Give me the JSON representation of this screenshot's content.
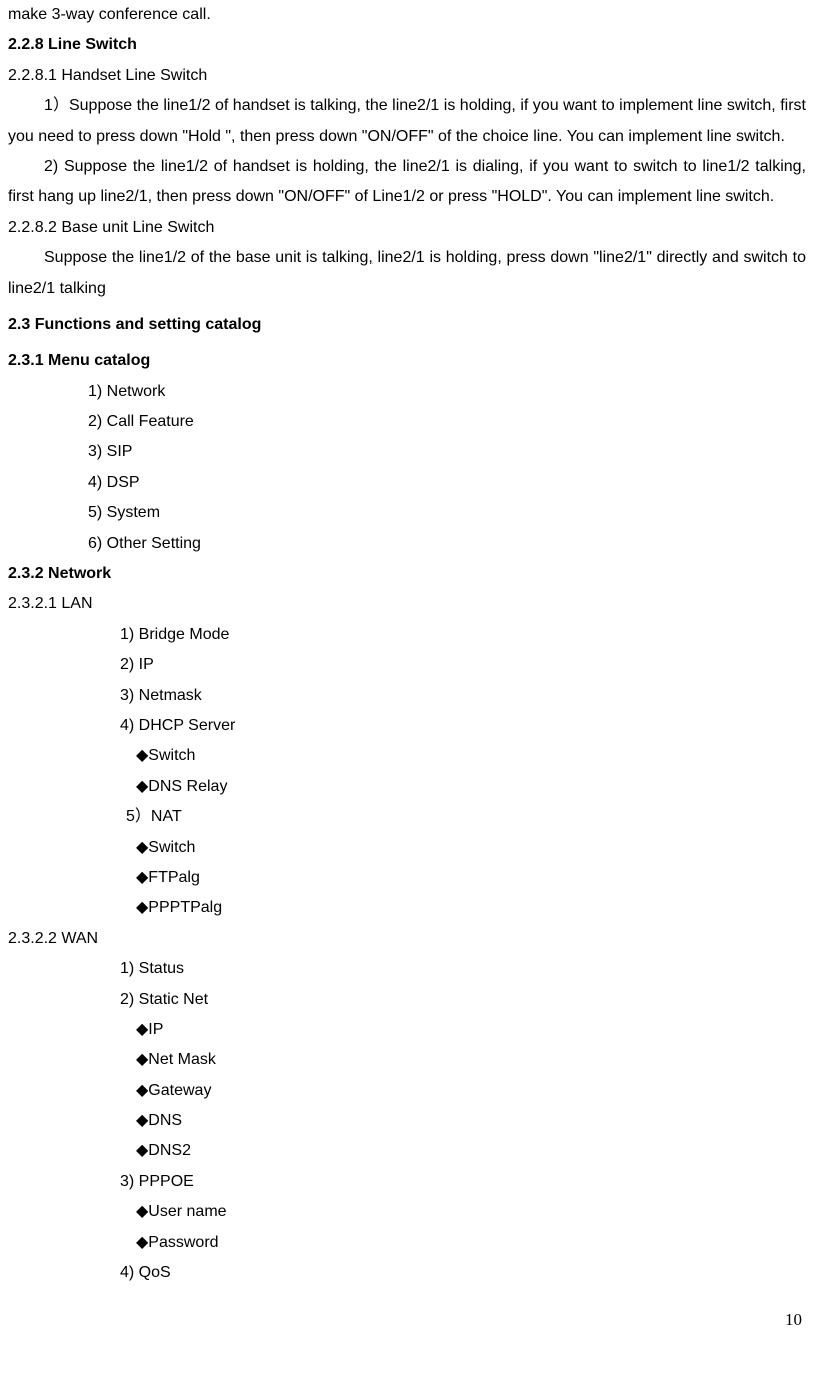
{
  "intro_line": "make 3-way conference call.",
  "s228_title": "2.2.8 Line Switch",
  "s2281_title": "2.2.8.1 Handset Line Switch",
  "s2281_p1_a": "1",
  "s2281_p1_b": "）",
  "s2281_p1_c": "Suppose the line1/2 of handset is talking, the line2/1 is holding, if you want to implement line switch, first you need to press down \"Hold \", then press down \"ON/OFF\" of the choice line. You can implement line switch.",
  "s2281_p2": "2) Suppose the line1/2 of handset is holding, the line2/1 is dialing, if you want to switch to line1/2 talking, first hang up line2/1, then press down \"ON/OFF\" of Line1/2 or press \"HOLD\". You can implement line switch.",
  "s2282_title": "2.2.8.2 Base unit Line Switch",
  "s2282_p1_a": "Suppose the line1/2 of the base unit is talking",
  "s2282_p1_comma": ",",
  "s2282_p1_b": " line2/1 is holding, press down \"line2/1\" directly and switch to line2/1 talking",
  "s23_title": "2.3 Functions and setting catalog",
  "s231_title": "2.3.1 Menu catalog",
  "menu_catalog": [
    "1) Network",
    "2) Call Feature",
    "3) SIP",
    "4) DSP",
    "5) System",
    "6) Other Setting"
  ],
  "s232_title": "2.3.2 Network",
  "s2321_title": "2.3.2.1  LAN",
  "lan_items": [
    "1)   Bridge Mode",
    "2)   IP",
    "3)   Netmask",
    "4)   DHCP Server"
  ],
  "dhcp_items": [
    "◆Switch",
    "◆DNS Relay"
  ],
  "nat_title": "5）NAT",
  "nat_items": [
    "◆Switch",
    "◆FTPalg",
    "◆PPPTPalg"
  ],
  "s2322_title": "2.3.2.2 WAN",
  "wan_items": [
    "1)   Status",
    "2)   Static Net"
  ],
  "static_net_items": [
    "◆IP",
    "◆Net Mask",
    "◆Gateway",
    "◆DNS",
    "◆DNS2"
  ],
  "pppoe_title": "3) PPPOE",
  "pppoe_items": [
    "◆User name",
    "◆Password"
  ],
  "qos_title": "4) QoS",
  "page_number": "10"
}
